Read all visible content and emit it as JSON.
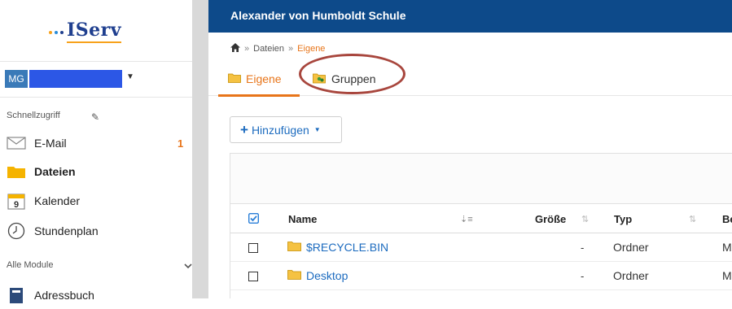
{
  "logo": {
    "text": "IServ",
    "dot_colors": [
      "#f7a21b",
      "#2a8cd8",
      "#1f3f8f"
    ]
  },
  "user": {
    "initials": "MG"
  },
  "sidebar": {
    "quick_access_label": "Schnellzugriff",
    "all_modules_label": "Alle Module",
    "items": [
      {
        "label": "E-Mail",
        "icon": "mail-icon",
        "badge": "1"
      },
      {
        "label": "Dateien",
        "icon": "folder-icon",
        "active": true
      },
      {
        "label": "Kalender",
        "icon": "calendar-icon",
        "icon_text": "9"
      },
      {
        "label": "Stundenplan",
        "icon": "clock-icon"
      },
      {
        "label": "Adressbuch",
        "icon": "addressbook-icon"
      }
    ]
  },
  "header": {
    "school_name": "Alexander von Humboldt Schule"
  },
  "breadcrumb": {
    "items": [
      "Dateien",
      "Eigene"
    ],
    "separator": "»"
  },
  "tabs": [
    {
      "label": "Eigene",
      "active": true
    },
    {
      "label": "Gruppen",
      "active": false
    }
  ],
  "add_button": {
    "label": "Hinzufügen"
  },
  "table": {
    "columns": {
      "name": "Name",
      "size": "Größe",
      "type": "Typ",
      "owner": "Be"
    },
    "rows": [
      {
        "name": "$RECYCLE.BIN",
        "size": "-",
        "type": "Ordner",
        "owner": "M"
      },
      {
        "name": "Desktop",
        "size": "-",
        "type": "Ordner",
        "owner": "M"
      }
    ]
  },
  "colors": {
    "accent": "#e8751a",
    "header_bg": "#0d4a8a",
    "link": "#1c6bbf",
    "annotation": "#a8463d"
  }
}
